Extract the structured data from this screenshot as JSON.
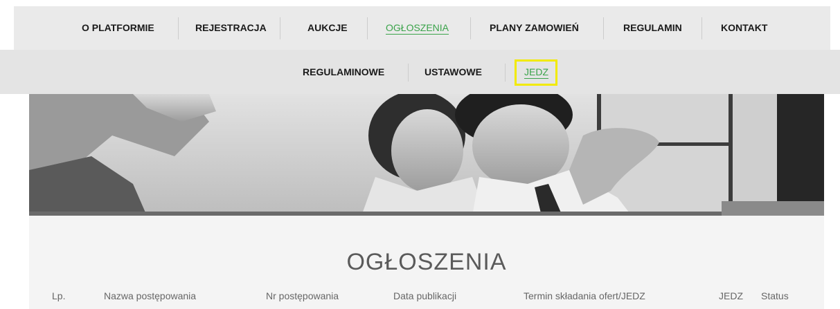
{
  "nav": {
    "items": [
      {
        "label": "O PLATFORMIE"
      },
      {
        "label": "REJESTRACJA"
      },
      {
        "label": "AUKCJE"
      },
      {
        "label": "OGŁOSZENIA"
      },
      {
        "label": "PLANY ZAMOWIEŃ"
      },
      {
        "label": "REGULAMIN"
      },
      {
        "label": "KONTAKT"
      }
    ],
    "active": "OGŁOSZENIA"
  },
  "subnav": {
    "items": [
      {
        "label": "REGULAMINOWE"
      },
      {
        "label": "USTAWOWE"
      },
      {
        "label": "JEDZ"
      }
    ],
    "active": "JEDZ"
  },
  "page": {
    "title": "OGŁOSZENIA"
  },
  "table": {
    "columns": [
      "Lp.",
      "Nazwa postępowania",
      "Nr postępowania",
      "Data publikacji",
      "Termin składania ofert/JEDZ",
      "JEDZ",
      "Status"
    ]
  },
  "colors": {
    "accent": "#3aa34a",
    "highlight": "#f2ea00",
    "nav_bg": "#eaeaea",
    "subnav_bg": "#e4e4e4"
  }
}
